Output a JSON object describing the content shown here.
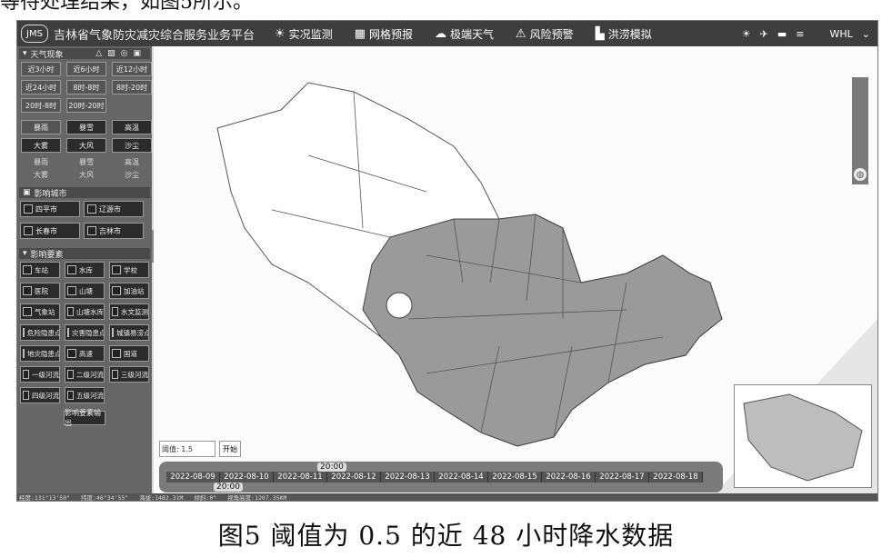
{
  "top_caption": "等待处理结果，如图5所示。",
  "app": {
    "logo": "JMS",
    "title": "吉林省气象防灾减灾综合服务业务平台"
  },
  "nav": [
    {
      "icon": "☀",
      "label": "实况监测"
    },
    {
      "icon": "▦",
      "label": "网格预报"
    },
    {
      "icon": "☁",
      "label": "极端天气"
    },
    {
      "icon": "⚠",
      "label": "风险预警"
    },
    {
      "icon": "▙",
      "label": "洪涝模拟"
    }
  ],
  "topright": {
    "icons": [
      "☀",
      "✈",
      "▬",
      "≡"
    ],
    "user": "WHL",
    "caret": "⌄"
  },
  "weather_section": {
    "title": "天气现象",
    "time_buttons": [
      "近3小时",
      "近6小时",
      "近12小时",
      "近24小时",
      "8时-8时",
      "8时-20时",
      "20时-8时",
      "20时-20时"
    ],
    "type_buttons": [
      "暴雨",
      "暴雪",
      "高温",
      "大雾",
      "大风",
      "沙尘"
    ],
    "sub_items": [
      "暴雨",
      "暴雪",
      "高温",
      "大雾",
      "大风",
      "沙尘"
    ]
  },
  "city_section": {
    "title": "影响城市",
    "cities": [
      "四平市",
      "辽源市",
      "长春市",
      "吉林市"
    ]
  },
  "element_section": {
    "title": "影响要素",
    "items": [
      "车站",
      "水库",
      "学校",
      "医院",
      "山塘",
      "加油站",
      "气象站",
      "山塘水库",
      "水文监测",
      "危险隐患点",
      "灾害隐患点",
      "城镇易涝点",
      "地灾隐患点",
      "高速",
      "国道",
      "一级河流",
      "二级河流",
      "三级河流",
      "四级河流",
      "五级河流"
    ],
    "export_label": "影响要素输出"
  },
  "threshold": {
    "label": "阈值",
    "value": "1.5",
    "button": "开始"
  },
  "timeline": {
    "top_time": "20:00",
    "bottom_time": "20:00",
    "dates": [
      "2022-08-09",
      "2022-08-10",
      "2022-08-11",
      "2022-08-12",
      "2022-08-13",
      "2022-08-14",
      "2022-08-15",
      "2022-08-16",
      "2022-08-17",
      "2022-08-18"
    ]
  },
  "statusbar": {
    "lon": "经度:131°13'50\"",
    "lat": "纬度:46°34'55\"",
    "alt": "海拔:1482.31M",
    "tilt": "倾斜:0°",
    "view": "视角高度:1207.35KM"
  },
  "bottom_caption": "图5   阈值为 0.5 的近 48 小时降水数据"
}
